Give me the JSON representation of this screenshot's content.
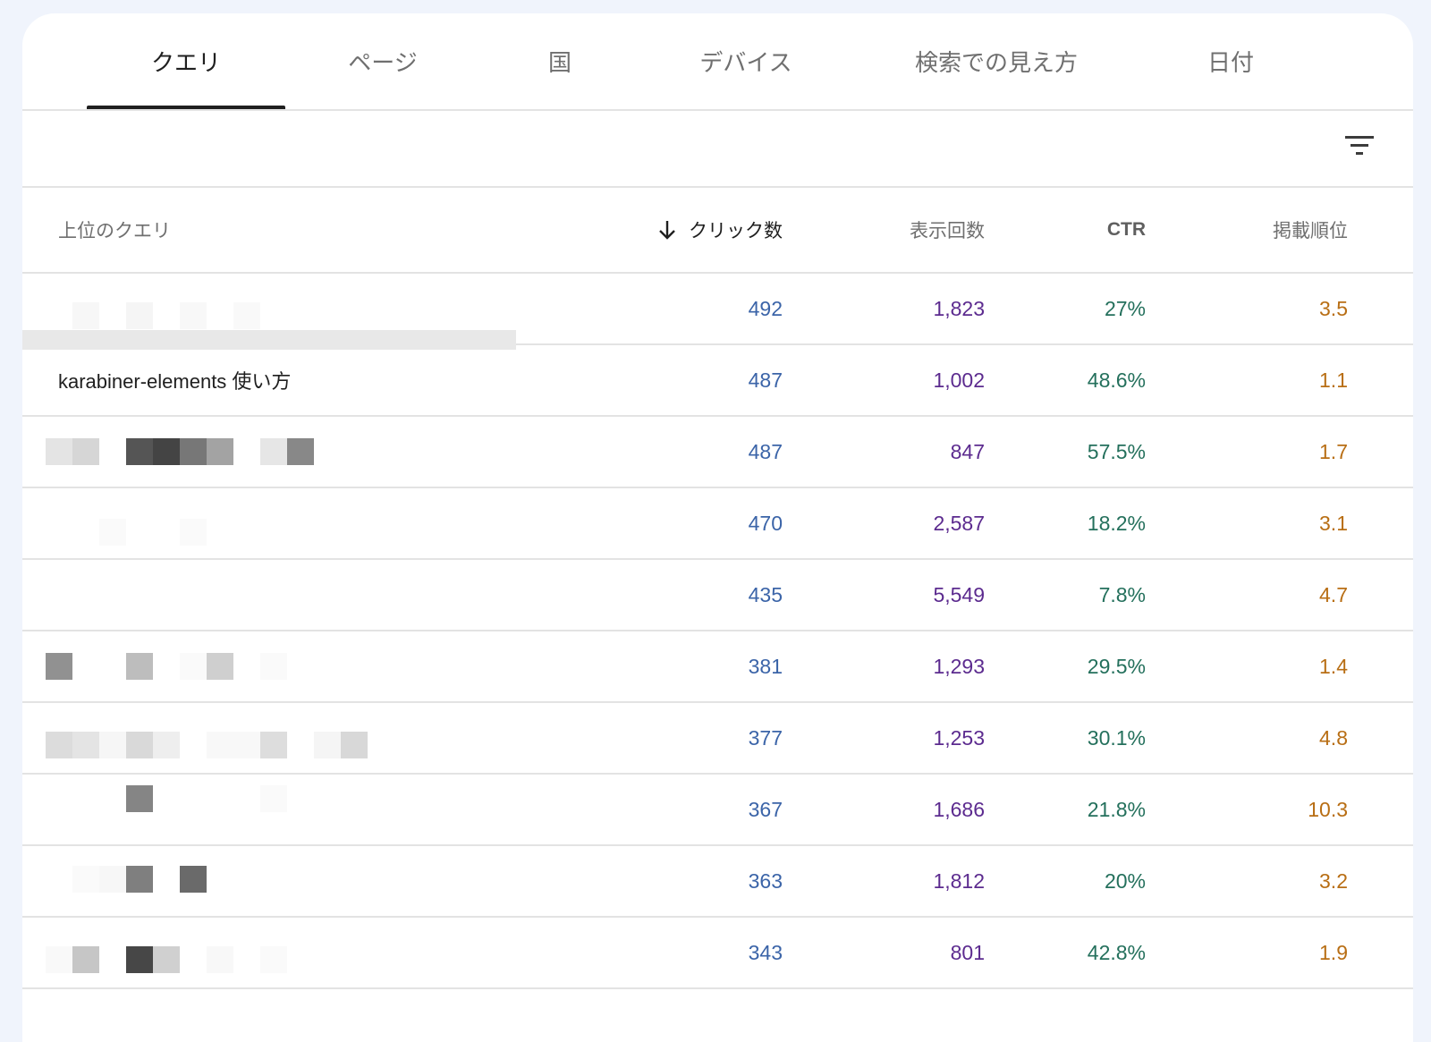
{
  "tabs": [
    {
      "label": "クエリ",
      "active": true
    },
    {
      "label": "ページ",
      "active": false
    },
    {
      "label": "国",
      "active": false
    },
    {
      "label": "デバイス",
      "active": false
    },
    {
      "label": "検索での見え方",
      "active": false
    },
    {
      "label": "日付",
      "active": false
    }
  ],
  "filter": {
    "icon": "filter-icon"
  },
  "table": {
    "headers": {
      "query": "上位のクエリ",
      "clicks": "クリック数",
      "impressions": "表示回数",
      "ctr": "CTR",
      "position": "掲載順位"
    },
    "sort": {
      "column": "clicks",
      "direction": "descending",
      "icon": "arrow-down-icon"
    },
    "rows": [
      {
        "query": "",
        "clicks": "492",
        "impressions": "1,823",
        "ctr": "27%",
        "position": "3.5"
      },
      {
        "query": "karabiner-elements 使い方",
        "clicks": "487",
        "impressions": "1,002",
        "ctr": "48.6%",
        "position": "1.1"
      },
      {
        "query": "",
        "clicks": "487",
        "impressions": "847",
        "ctr": "57.5%",
        "position": "1.7"
      },
      {
        "query": "",
        "clicks": "470",
        "impressions": "2,587",
        "ctr": "18.2%",
        "position": "3.1"
      },
      {
        "query": "",
        "clicks": "435",
        "impressions": "5,549",
        "ctr": "7.8%",
        "position": "4.7"
      },
      {
        "query": "",
        "clicks": "381",
        "impressions": "1,293",
        "ctr": "29.5%",
        "position": "1.4"
      },
      {
        "query": "",
        "clicks": "377",
        "impressions": "1,253",
        "ctr": "30.1%",
        "position": "4.8"
      },
      {
        "query": "",
        "clicks": "367",
        "impressions": "1,686",
        "ctr": "21.8%",
        "position": "10.3"
      },
      {
        "query": "",
        "clicks": "363",
        "impressions": "1,812",
        "ctr": "20%",
        "position": "3.2"
      },
      {
        "query": "",
        "clicks": "343",
        "impressions": "801",
        "ctr": "42.8%",
        "position": "1.9"
      }
    ]
  },
  "colors": {
    "clicks": "#3b64a8",
    "impressions": "#5c2b8f",
    "ctr": "#24705c",
    "position": "#b86e14",
    "background": "#f0f4fc"
  }
}
